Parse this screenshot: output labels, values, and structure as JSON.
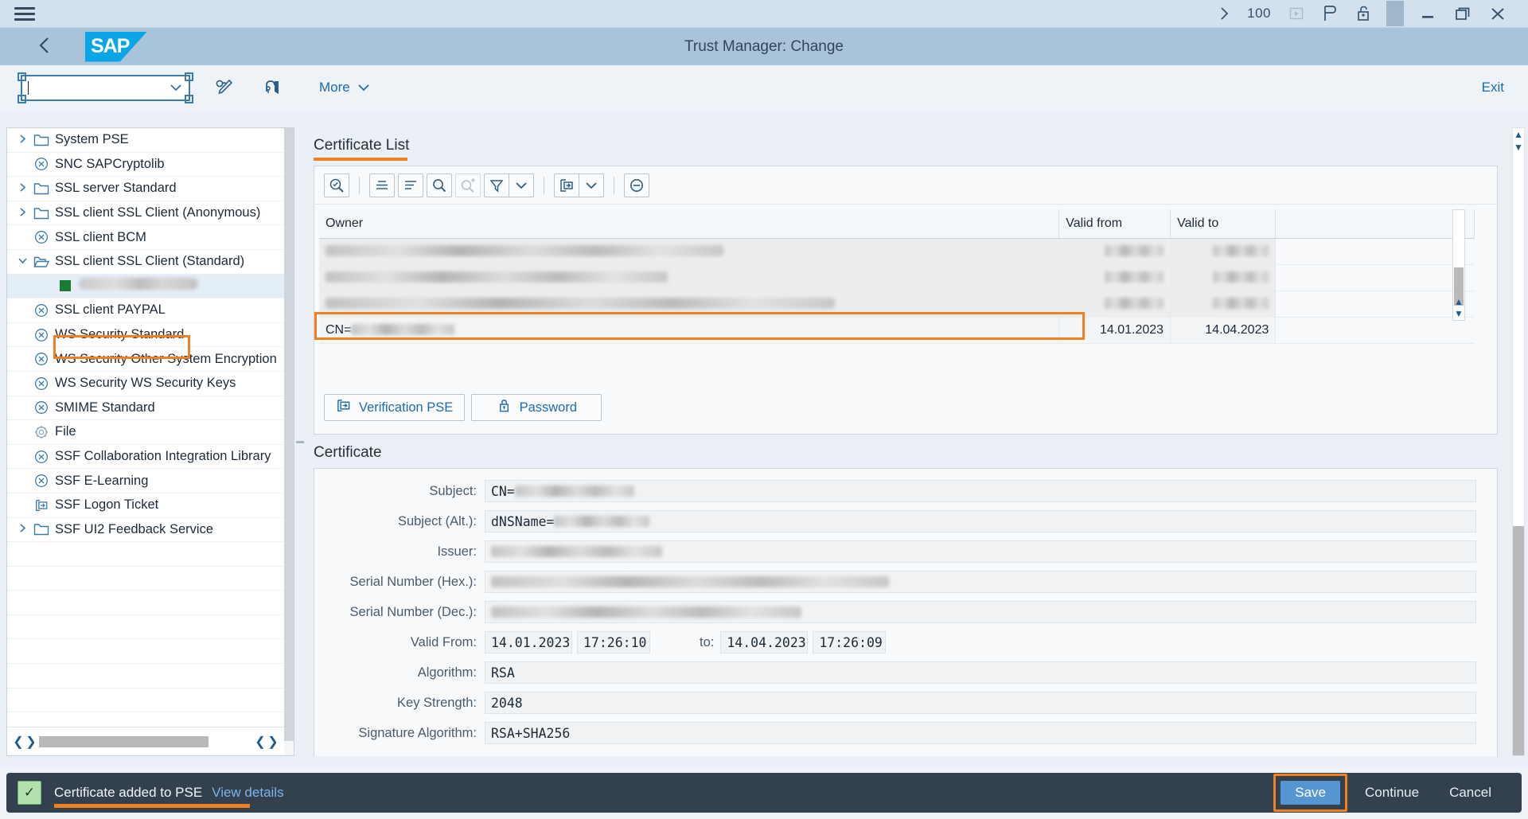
{
  "shell": {
    "menu_icon": "hamburger-icon",
    "expand_icon": "chevron-right-icon",
    "ok_code_value": "100",
    "play_icon": "play-icon",
    "personalize_icon": "personalize-icon",
    "lock_icon": "unlock-icon",
    "minimize_icon": "minimize-icon",
    "restore_icon": "restore-icon",
    "close_icon": "close-icon"
  },
  "header": {
    "back_icon": "back-chevron-icon",
    "logo_text": "SAP",
    "title": "Trust Manager: Change"
  },
  "toolbar": {
    "command_value": "",
    "command_placeholder": "",
    "dropdown_icon": "chevron-down-icon",
    "icon1": "glasses-pencil-icon",
    "icon2": "key-lock-icon",
    "more_label": "More",
    "more_caret_icon": "chevron-down-icon",
    "exit_label": "Exit"
  },
  "sidebar": {
    "items": [
      {
        "label": "System PSE",
        "icon": "folder-icon",
        "expandable": true,
        "expanded": false,
        "blurred": false,
        "selected": false
      },
      {
        "label": "SNC SAPCryptolib",
        "icon": "x-circle-icon",
        "expandable": false,
        "expanded": false,
        "blurred": false,
        "selected": false
      },
      {
        "label": "SSL server Standard",
        "icon": "folder-icon",
        "expandable": true,
        "expanded": false,
        "blurred": false,
        "selected": false
      },
      {
        "label": "SSL client SSL Client (Anonymous)",
        "icon": "folder-icon",
        "expandable": true,
        "expanded": false,
        "blurred": false,
        "selected": false
      },
      {
        "label": "SSL client BCM",
        "icon": "x-circle-icon",
        "expandable": false,
        "expanded": false,
        "blurred": false,
        "selected": false
      },
      {
        "label": "SSL client SSL Client (Standard)",
        "icon": "open-folder-icon",
        "expandable": true,
        "expanded": true,
        "blurred": false,
        "selected": false
      },
      {
        "label": "",
        "icon": "green-square-icon",
        "expandable": false,
        "expanded": false,
        "blurred": true,
        "selected": true
      },
      {
        "label": "SSL client PAYPAL",
        "icon": "x-circle-icon",
        "expandable": false,
        "expanded": false,
        "blurred": false,
        "selected": false
      },
      {
        "label": "WS Security Standard",
        "icon": "x-circle-icon",
        "expandable": false,
        "expanded": false,
        "blurred": false,
        "selected": false
      },
      {
        "label": "WS Security Other System Encryption",
        "icon": "x-circle-icon",
        "expandable": false,
        "expanded": false,
        "blurred": false,
        "selected": false
      },
      {
        "label": "WS Security WS Security Keys",
        "icon": "x-circle-icon",
        "expandable": false,
        "expanded": false,
        "blurred": false,
        "selected": false
      },
      {
        "label": "SMIME Standard",
        "icon": "x-circle-icon",
        "expandable": false,
        "expanded": false,
        "blurred": false,
        "selected": false
      },
      {
        "label": "File",
        "icon": "gear-icon",
        "expandable": false,
        "expanded": false,
        "blurred": false,
        "selected": false
      },
      {
        "label": "SSF Collaboration Integration Library",
        "icon": "x-circle-icon",
        "expandable": false,
        "expanded": false,
        "blurred": false,
        "selected": false
      },
      {
        "label": "SSF E-Learning",
        "icon": "x-circle-icon",
        "expandable": false,
        "expanded": false,
        "blurred": false,
        "selected": false
      },
      {
        "label": "SSF Logon Ticket",
        "icon": "import-icon",
        "expandable": false,
        "expanded": false,
        "blurred": false,
        "selected": false
      },
      {
        "label": "SSF UI2 Feedback Service",
        "icon": "folder-icon",
        "expandable": true,
        "expanded": false,
        "blurred": false,
        "selected": false
      }
    ],
    "scroll_left_icon": "chevron-left-icon",
    "scroll_right_icon": "chevron-right-icon"
  },
  "certificate_list": {
    "section_title": "Certificate List",
    "toolbar_buttons": [
      {
        "name": "display-details-button",
        "icon": "magnifier-check-icon",
        "disabled": false
      },
      {
        "name": "sort-ascending-button",
        "icon": "sort-ascending-icon",
        "disabled": false
      },
      {
        "name": "sort-descending-button",
        "icon": "sort-descending-icon",
        "disabled": false
      },
      {
        "name": "find-button",
        "icon": "magnifier-icon",
        "disabled": false
      },
      {
        "name": "find-next-button",
        "icon": "magnifier-plus-icon",
        "disabled": true
      },
      {
        "name": "filter-button",
        "icon": "filter-icon",
        "disabled": false
      },
      {
        "name": "filter-menu-button",
        "icon": "chevron-down-icon",
        "disabled": false
      },
      {
        "name": "export-button",
        "icon": "export-icon",
        "disabled": false
      },
      {
        "name": "export-menu-button",
        "icon": "chevron-down-icon",
        "disabled": false
      },
      {
        "name": "remove-button",
        "icon": "minus-circle-icon",
        "disabled": false
      }
    ],
    "columns": [
      "Owner",
      "Valid from",
      "Valid to",
      ""
    ],
    "rows": [
      {
        "owner": "",
        "owner_blurred": true,
        "valid_from": "",
        "valid_from_blurred": true,
        "valid_to": "",
        "valid_to_blurred": true,
        "highlighted": false
      },
      {
        "owner": "",
        "owner_blurred": true,
        "valid_from": "",
        "valid_from_blurred": true,
        "valid_to": "",
        "valid_to_blurred": true,
        "highlighted": false
      },
      {
        "owner": "",
        "owner_blurred": true,
        "valid_from": "",
        "valid_from_blurred": true,
        "valid_to": "",
        "valid_to_blurred": true,
        "highlighted": false
      },
      {
        "owner": "CN=",
        "owner_blurred": true,
        "valid_from": "14.01.2023",
        "valid_from_blurred": false,
        "valid_to": "14.04.2023",
        "valid_to_blurred": false,
        "highlighted": true
      }
    ],
    "verification_pse_label": "Verification PSE",
    "verification_pse_icon": "import-icon",
    "password_label": "Password",
    "password_icon": "lock-icon",
    "scroll_up_icon": "chevron-up-icon",
    "scroll_down_icon": "chevron-down-icon"
  },
  "certificate": {
    "section_title": "Certificate",
    "fields": [
      {
        "label": "Subject:",
        "value": "CN=",
        "blurred": true
      },
      {
        "label": "Subject (Alt.):",
        "value": "dNSName=",
        "blurred": true
      },
      {
        "label": "Issuer:",
        "value": "",
        "blurred": true
      },
      {
        "label": "Serial Number (Hex.):",
        "value": "",
        "blurred": true
      },
      {
        "label": "Serial Number (Dec.):",
        "value": "",
        "blurred": true
      }
    ],
    "valid_from_label": "Valid From:",
    "valid_from_date": "14.01.2023",
    "valid_from_time": "17:26:10",
    "to_label": "to:",
    "valid_to_date": "14.04.2023",
    "valid_to_time": "17:26:09",
    "algorithm_label": "Algorithm:",
    "algorithm_value": "RSA",
    "key_strength_label": "Key Strength:",
    "key_strength_value": "2048",
    "signature_algorithm_label": "Signature Algorithm:",
    "signature_algorithm_value": "RSA+SHA256"
  },
  "footer": {
    "status_icon": "success-check-icon",
    "message": "Certificate added to PSE",
    "details_link": "View details",
    "save_label": "Save",
    "continue_label": "Continue",
    "cancel_label": "Cancel"
  },
  "colors": {
    "accent_orange": "#f08020",
    "sap_blue": "#08a6e4",
    "header_blue": "#a9c3db",
    "shell_blue": "#d3e0ed",
    "link_blue": "#1d6ab0",
    "footer_dark": "#33414f",
    "save_blue": "#5596d2",
    "success_green": "#b4e0b0"
  }
}
